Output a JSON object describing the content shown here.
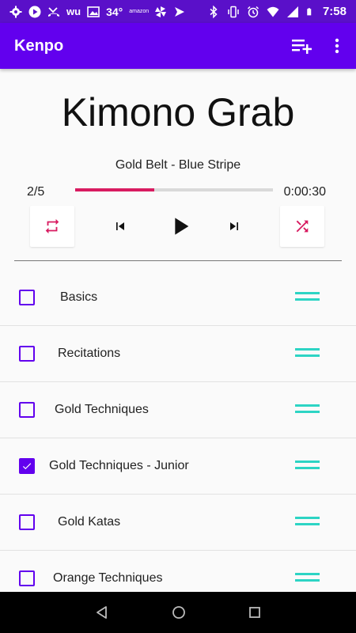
{
  "status_bar": {
    "temperature": "34°",
    "amazon_badge": "amazon",
    "time": "7:58",
    "icons": [
      "gear-icon",
      "play-icon",
      "missed-call-icon",
      "wu-icon",
      "photos-icon",
      "bluetooth-icon",
      "vibrate-icon",
      "alarm-icon",
      "wifi-icon",
      "signal-icon",
      "battery-icon"
    ]
  },
  "app_bar": {
    "title": "Kenpo",
    "actions": [
      "playlist-add-icon",
      "more-vert-icon"
    ]
  },
  "player": {
    "title": "Kimono Grab",
    "subtitle": "Gold Belt - Blue Stripe",
    "position": "2/5",
    "time": "0:00:30",
    "progress": 0.4,
    "accent": "#d81b60"
  },
  "playlist": [
    {
      "label": "Basics",
      "checked": false
    },
    {
      "label": "Recitations",
      "checked": false
    },
    {
      "label": "Gold Techniques",
      "checked": false
    },
    {
      "label": "Gold Techniques - Junior",
      "checked": true
    },
    {
      "label": "Gold Katas",
      "checked": false
    },
    {
      "label": "Orange Techniques",
      "checked": false
    }
  ],
  "colors": {
    "primary": "#6200ee",
    "status_bar": "#5a10c9",
    "handle": "#2dd4c4"
  }
}
